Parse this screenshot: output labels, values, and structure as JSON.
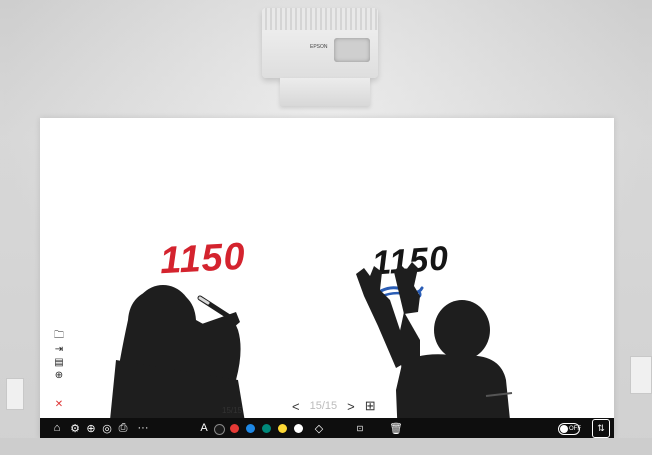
{
  "projector": {
    "brand": "EPSON"
  },
  "board": {
    "ink_red_text": "1150",
    "ink_black_text": "1150",
    "ink_colors": {
      "red": "#d4232e",
      "black": "#151515",
      "blue": "#2a5db5"
    }
  },
  "sidebar": {
    "items": [
      {
        "icon": "folder-icon",
        "glyph": "🗀"
      },
      {
        "icon": "import-icon",
        "glyph": "⇥"
      },
      {
        "icon": "layout-icon",
        "glyph": "▤"
      },
      {
        "icon": "zoom-icon",
        "glyph": "⊕"
      }
    ],
    "delete_glyph": "✕"
  },
  "page_nav": {
    "prev_glyph": "<",
    "current": "15/15",
    "next_glyph": ">",
    "add_glyph": "⊞"
  },
  "page_count_label": "15/15",
  "toolbar": {
    "home_glyph": "⌂",
    "glyphs": [
      "⚙",
      "⊕",
      "◎",
      "⎙",
      "···"
    ],
    "text_tool": "A",
    "colors": [
      "#1a1a1a",
      "#e53935",
      "#1e88e5",
      "#00897b",
      "#fdd835",
      "#ffffff"
    ],
    "eraser_glyph": "◇",
    "right_tools_label": "⊡",
    "delete_glyph": "🗑",
    "toggle_label": "OFF",
    "swap_glyph": "⇅"
  }
}
